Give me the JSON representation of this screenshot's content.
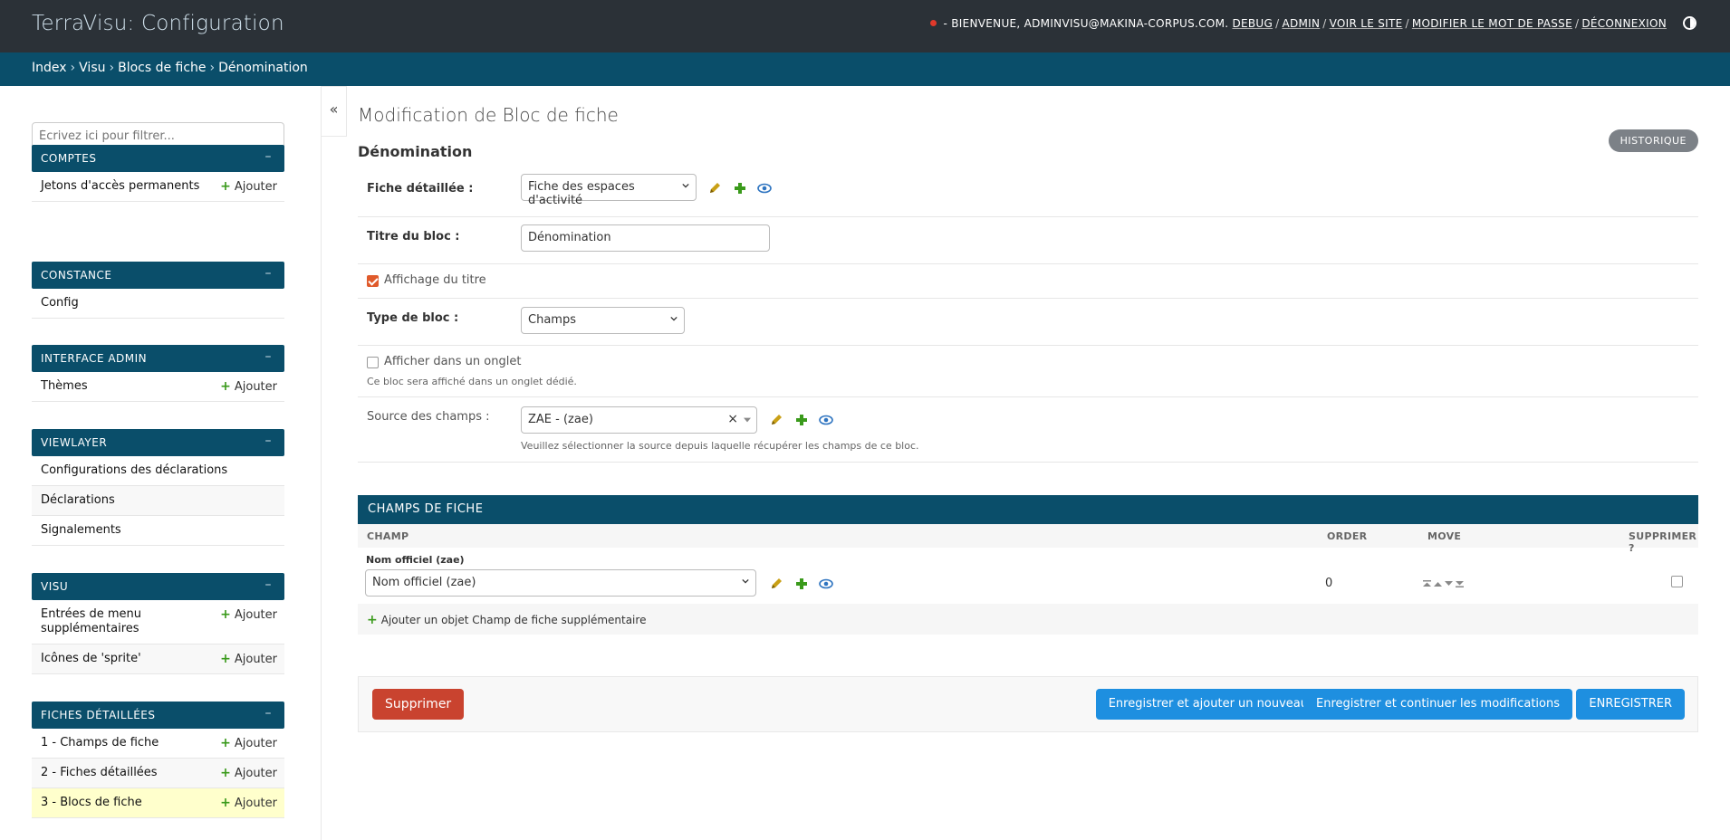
{
  "header": {
    "brand": "TerraVisu: Configuration",
    "welcome": "- BIENVENUE, ADMINVISU@MAKINA-CORPUS.COM.",
    "links": [
      "DEBUG",
      "ADMIN",
      "VOIR LE SITE",
      "MODIFIER LE MOT DE PASSE",
      "DÉCONNEXION"
    ],
    "status_color": "#e0392b"
  },
  "breadcrumbs": [
    "Index",
    "Visu",
    "Blocs de fiche",
    "Dénomination"
  ],
  "sidebar": {
    "filter_placeholder": "Écrivez ici pour filtrer...",
    "add_label": "Ajouter",
    "collapse_symbol": "–",
    "toggle_symbol": "«",
    "modules": [
      {
        "caption": "COMPTES",
        "items": [
          {
            "label": "Jetons d'accès permanents",
            "add": true
          }
        ]
      },
      {
        "caption": "CONSTANCE",
        "items": [
          {
            "label": "Config",
            "add": false
          }
        ]
      },
      {
        "caption": "INTERFACE ADMIN",
        "items": [
          {
            "label": "Thèmes",
            "add": true
          }
        ]
      },
      {
        "caption": "VIEWLAYER",
        "items": [
          {
            "label": "Configurations des déclarations",
            "add": false
          },
          {
            "label": "Déclarations",
            "add": false
          },
          {
            "label": "Signalements",
            "add": false
          }
        ]
      },
      {
        "caption": "VISU",
        "items": [
          {
            "label": "Entrées de menu supplémentaires",
            "add": true
          },
          {
            "label": "Icônes de 'sprite'",
            "add": true
          }
        ]
      },
      {
        "caption": "FICHES DÉTAILLÉES",
        "items": [
          {
            "label": "1 - Champs de fiche",
            "add": true
          },
          {
            "label": "2 - Fiches détaillées",
            "add": true
          },
          {
            "label": "3 - Blocs de fiche",
            "add": true
          }
        ]
      }
    ]
  },
  "main": {
    "title": "Modification de Bloc de fiche",
    "history_label": "HISTORIQUE",
    "fieldset_title": "Dénomination",
    "fields": {
      "fiche_label": "Fiche détaillée :",
      "fiche_value": "Fiche des espaces d'activité",
      "titre_label": "Titre du bloc :",
      "titre_value": "Dénomination",
      "affichage_label": "Affichage du titre",
      "affichage_checked": true,
      "type_label": "Type de bloc :",
      "type_value": "Champs",
      "onglet_label": "Afficher dans un onglet",
      "onglet_checked": false,
      "onglet_help": "Ce bloc sera affiché dans un onglet dédié.",
      "source_label": "Source des champs :",
      "source_value": "ZAE - (zae)",
      "source_clear": "×",
      "source_help": "Veuillez sélectionner la source depuis laquelle récupérer les champs de ce bloc."
    },
    "inline": {
      "caption": "CHAMPS DE FICHE",
      "columns": [
        "CHAMP",
        "ORDER",
        "MOVE",
        "SUPPRIMER ?"
      ],
      "row": {
        "label": "Nom officiel (zae)",
        "value": "Nom officiel (zae)",
        "order": "0",
        "delete_checked": false
      },
      "add_label": "Ajouter un objet Champ de fiche supplémentaire"
    },
    "submit": {
      "delete": "Supprimer",
      "save_add": "Enregistrer et ajouter un nouveau",
      "save_continue": "Enregistrer et continuer les modifications",
      "save": "ENREGISTRER"
    }
  }
}
